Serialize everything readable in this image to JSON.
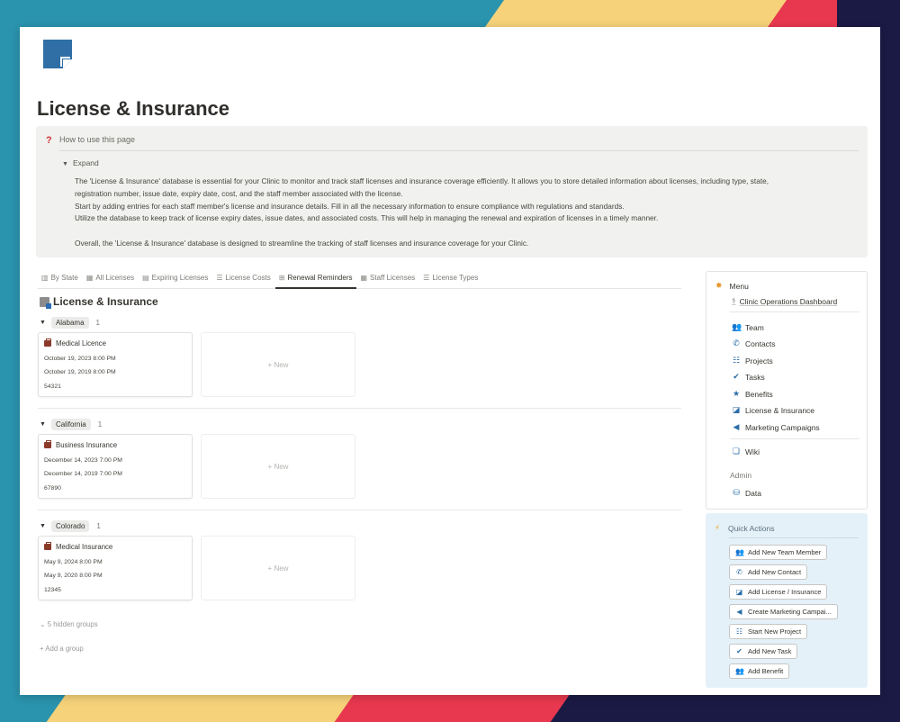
{
  "page": {
    "title": "License & Insurance"
  },
  "callout": {
    "heading": "How to use this page",
    "toggle": "Expand",
    "lines": [
      "The 'License & Insurance' database is essential for your  Clinic to monitor and track staff licenses and insurance coverage efficiently. It allows you to store detailed information about licenses, including type, state,",
      "registration number, issue date, expiry date, cost, and the staff member associated with the license.",
      "Start by adding entries for each staff member's license and insurance details. Fill in all the necessary information to ensure compliance with regulations and standards.",
      "Utilize the database to keep track of license expiry dates, issue dates, and associated costs. This will help in managing the renewal and expiration of licenses in a timely manner.",
      "Overall, the 'License & Insurance' database is designed to streamline the tracking of staff licenses and insurance coverage for your  Clinic."
    ]
  },
  "tabs": [
    {
      "label": "By State",
      "icon": "board-icon"
    },
    {
      "label": "All Licenses",
      "icon": "table-icon"
    },
    {
      "label": "Expiring Licenses",
      "icon": "calendar-icon"
    },
    {
      "label": "License Costs",
      "icon": "list-icon"
    },
    {
      "label": "Renewal Reminders",
      "icon": "gallery-icon",
      "active": true
    },
    {
      "label": "Staff Licenses",
      "icon": "table-icon"
    },
    {
      "label": "License Types",
      "icon": "list-icon"
    }
  ],
  "database": {
    "title": "License & Insurance"
  },
  "groups": [
    {
      "name": "Alabama",
      "count": "1",
      "card": {
        "name": "Medical Licence",
        "expiry": "October 19, 2023 8:00 PM",
        "issue": "October 19, 2019 8:00 PM",
        "number": "54321"
      },
      "new_label": "+ New"
    },
    {
      "name": "California",
      "count": "1",
      "card": {
        "name": "Business Insurance",
        "expiry": "December 14, 2023 7:00 PM",
        "issue": "December 14, 2019 7:00 PM",
        "number": "67890"
      },
      "new_label": "+ New"
    },
    {
      "name": "Colorado",
      "count": "1",
      "card": {
        "name": "Medical Insurance",
        "expiry": "May 9, 2024 8:00 PM",
        "issue": "May 9, 2020 8:00 PM",
        "number": "12345"
      },
      "new_label": "+ New"
    }
  ],
  "hidden_groups": "5 hidden groups",
  "add_group": "+ Add a group",
  "menu": {
    "heading": "Menu",
    "dashboard": "Clinic Operations Dashboard",
    "items": [
      {
        "label": "Team",
        "icon": "team-icon"
      },
      {
        "label": "Contacts",
        "icon": "phone-icon"
      },
      {
        "label": "Projects",
        "icon": "checklist-icon"
      },
      {
        "label": "Tasks",
        "icon": "check-circle-icon"
      },
      {
        "label": "Benefits",
        "icon": "star-icon"
      },
      {
        "label": "License & Insurance",
        "icon": "note-icon"
      },
      {
        "label": "Marketing Campaigns",
        "icon": "megaphone-icon"
      }
    ],
    "wiki": "Wiki",
    "admin_label": "Admin",
    "data": "Data"
  },
  "quick_actions": {
    "heading": "Quick Actions",
    "buttons": [
      {
        "label": "Add New Team Member",
        "icon": "team-icon"
      },
      {
        "label": "Add New Contact",
        "icon": "phone-icon"
      },
      {
        "label": "Add License / Insurance",
        "icon": "note-icon"
      },
      {
        "label": "Create Marketing Campai...",
        "icon": "megaphone-icon"
      },
      {
        "label": "Start New Project",
        "icon": "checklist-icon"
      },
      {
        "label": "Add New Task",
        "icon": "check-circle-icon"
      },
      {
        "label": "Add Benefit",
        "icon": "team-icon"
      }
    ]
  },
  "colors": {
    "accent": "#2b6ea8",
    "callout_bg": "#f1f1ef",
    "quick_actions_bg": "#e5f1f9",
    "help_icon": "#d13838"
  }
}
